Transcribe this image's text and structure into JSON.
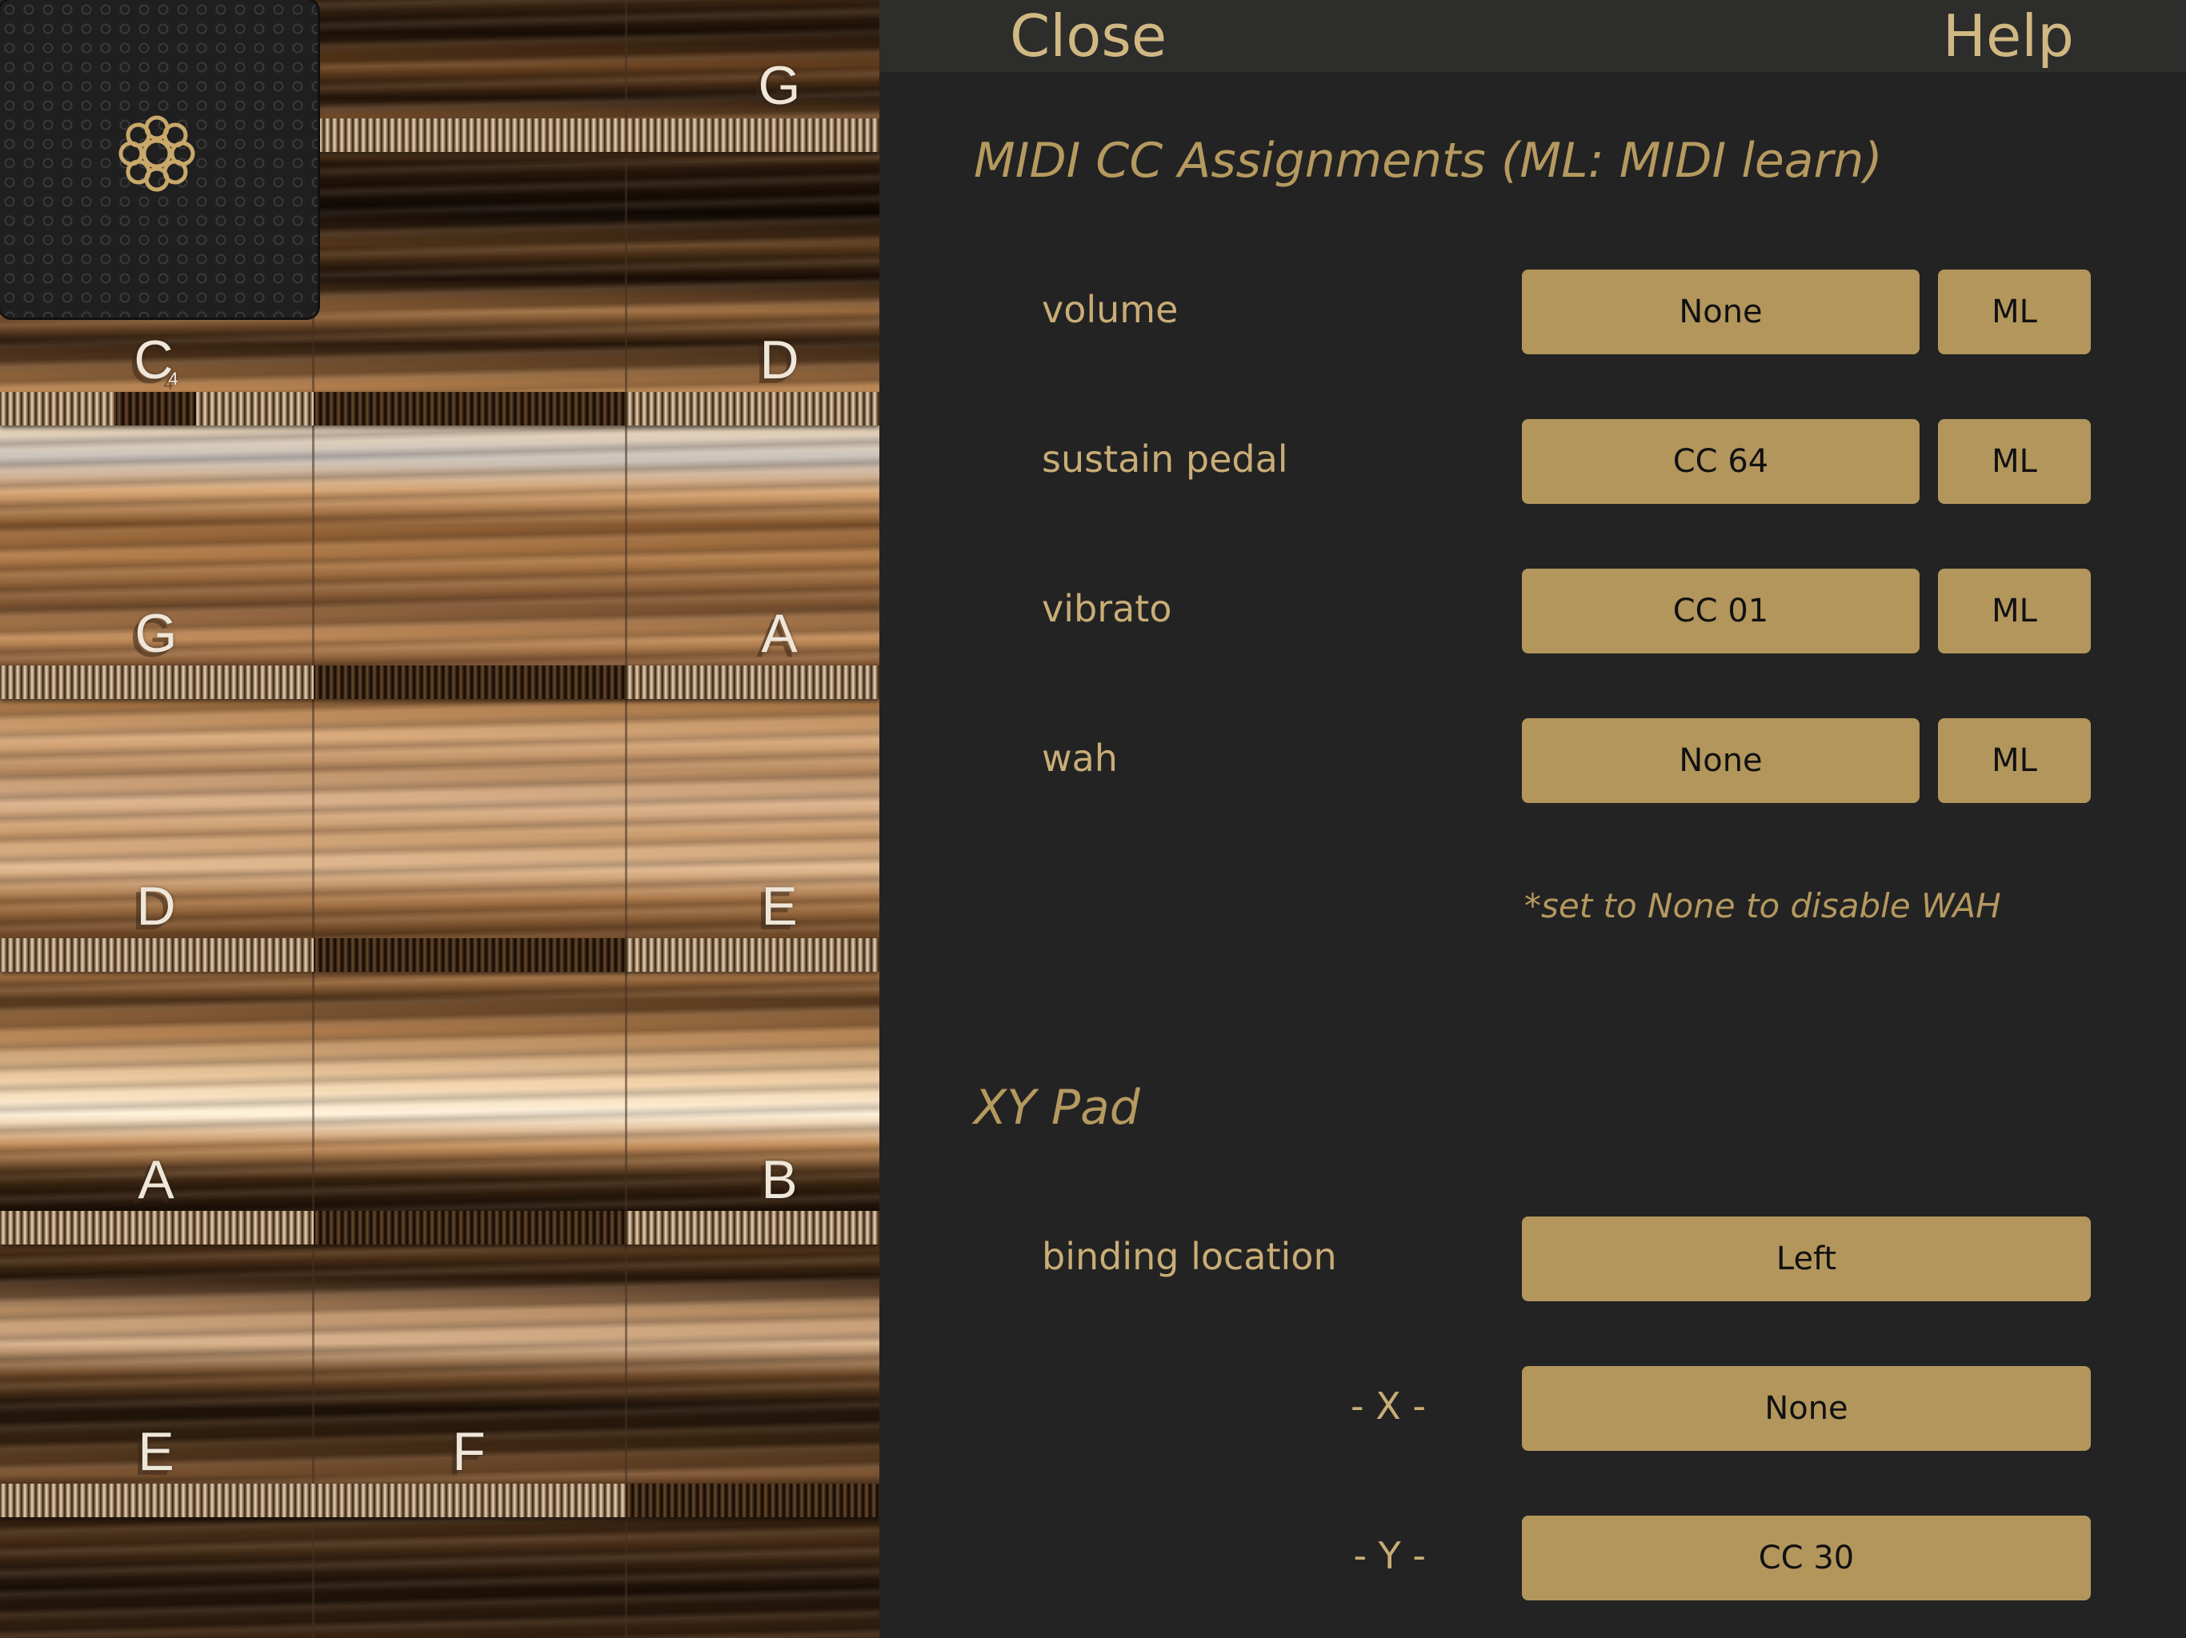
{
  "fretboard": {
    "notes": [
      {
        "id": "g-top",
        "label": "G",
        "sub": ""
      },
      {
        "id": "c4",
        "label": "C",
        "sub": "4"
      },
      {
        "id": "d",
        "label": "D",
        "sub": ""
      },
      {
        "id": "g",
        "label": "G",
        "sub": ""
      },
      {
        "id": "a",
        "label": "A",
        "sub": ""
      },
      {
        "id": "d2",
        "label": "D",
        "sub": ""
      },
      {
        "id": "e",
        "label": "E",
        "sub": ""
      },
      {
        "id": "a2",
        "label": "A",
        "sub": ""
      },
      {
        "id": "b",
        "label": "B",
        "sub": ""
      },
      {
        "id": "e2",
        "label": "E",
        "sub": ""
      },
      {
        "id": "f",
        "label": "F",
        "sub": ""
      }
    ]
  },
  "topbar": {
    "close_label": "Close",
    "help_label": "Help"
  },
  "midi": {
    "title": "MIDI CC Assignments  (ML: MIDI learn)",
    "rows": [
      {
        "label": "volume",
        "value": "None",
        "ml": "ML"
      },
      {
        "label": "sustain pedal",
        "value": "CC 64",
        "ml": "ML"
      },
      {
        "label": "vibrato",
        "value": "CC 01",
        "ml": "ML"
      },
      {
        "label": "wah",
        "value": "None",
        "ml": "ML"
      }
    ],
    "note": "*set to None to disable WAH"
  },
  "xy_pad": {
    "title": "XY Pad",
    "binding_label": "binding location",
    "binding_value": "Left",
    "x_label": "- X -",
    "x_value": "None",
    "y_label": "- Y -",
    "y_value": "CC 30"
  },
  "colors": {
    "accent": "#b3965c",
    "panel_bg": "#232323",
    "topbar_bg": "#2d2d2b",
    "text_gold": "#b5995f"
  }
}
